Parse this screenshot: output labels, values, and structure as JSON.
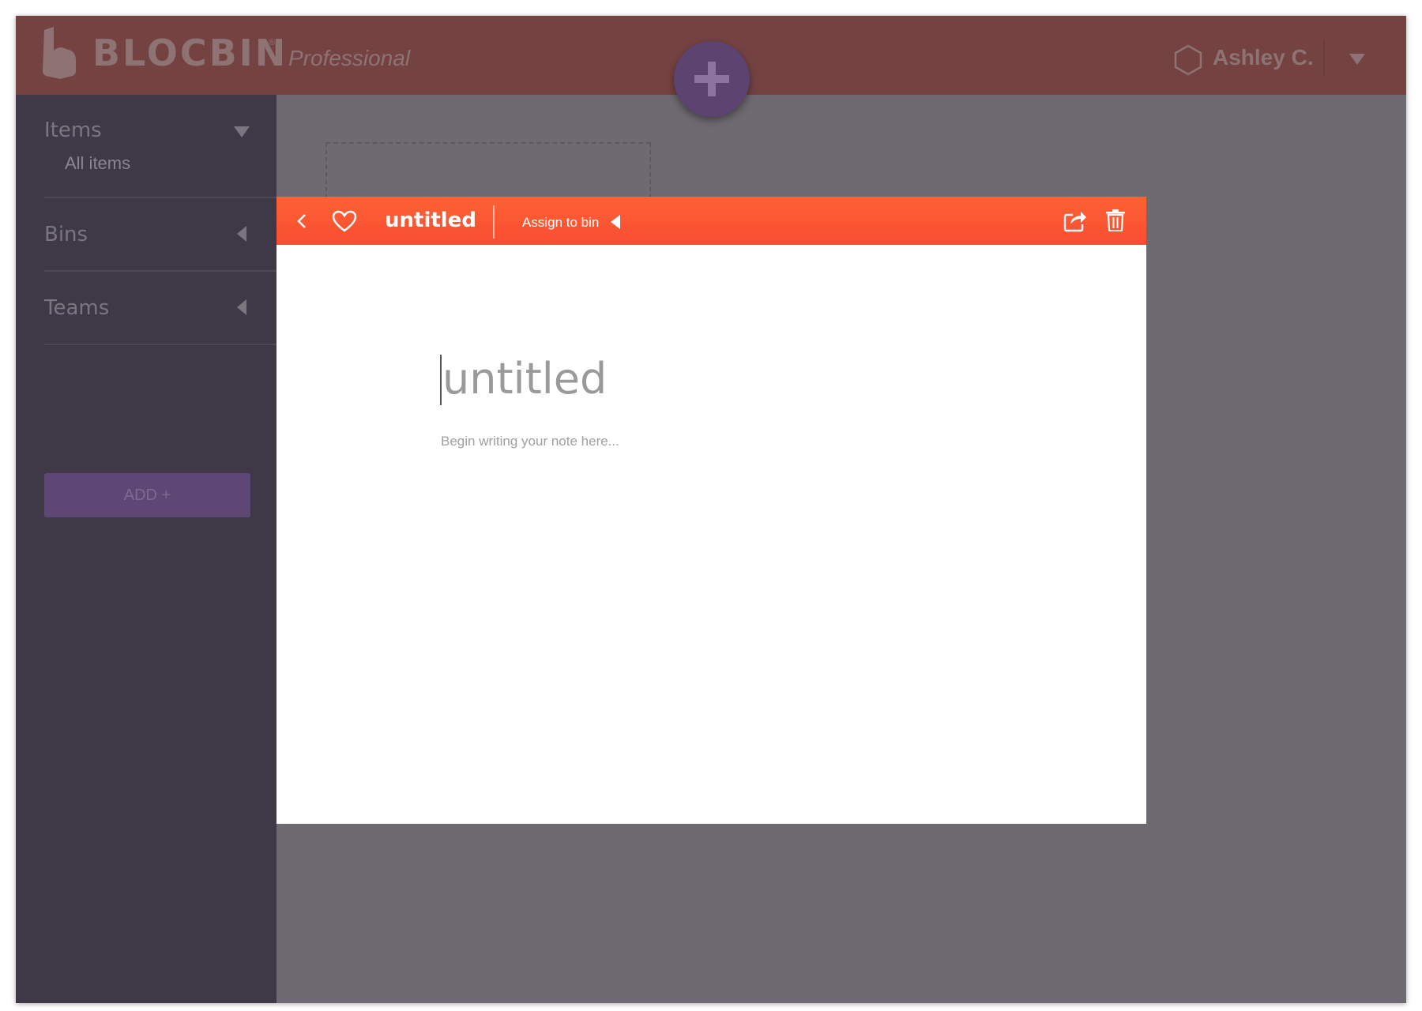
{
  "app": {
    "brand": "BLOCBIN",
    "registered_mark": "®",
    "edition": "Professional",
    "logo_icon": "blocbin-logo-icon"
  },
  "header": {
    "user_name": "Ashley C.",
    "user_icon": "hexagon-icon",
    "menu_icon": "caret-down-icon",
    "fab_icon": "plus-icon"
  },
  "sidebar": {
    "sections": [
      {
        "label": "Items",
        "caret": "caret-down-icon",
        "subitems": [
          "All items"
        ]
      },
      {
        "label": "Bins",
        "caret": "caret-left-icon"
      },
      {
        "label": "Teams",
        "caret": "caret-left-icon"
      }
    ],
    "add_button_label": "ADD +"
  },
  "editor": {
    "toolbar": {
      "title": "untitled",
      "assign_label": "Assign to bin",
      "icons": [
        "back-icon",
        "heart-icon",
        "caret-left-icon",
        "share-icon",
        "trash-icon"
      ]
    },
    "note_title": "untitled",
    "note_body_placeholder": "Begin writing your note here..."
  },
  "colors": {
    "header_bg": "#754242",
    "sidebar_bg": "#3f3846",
    "main_bg": "#6e6a71",
    "accent_purple": "#5e4675",
    "toolbar_orange": "#fa5533"
  }
}
